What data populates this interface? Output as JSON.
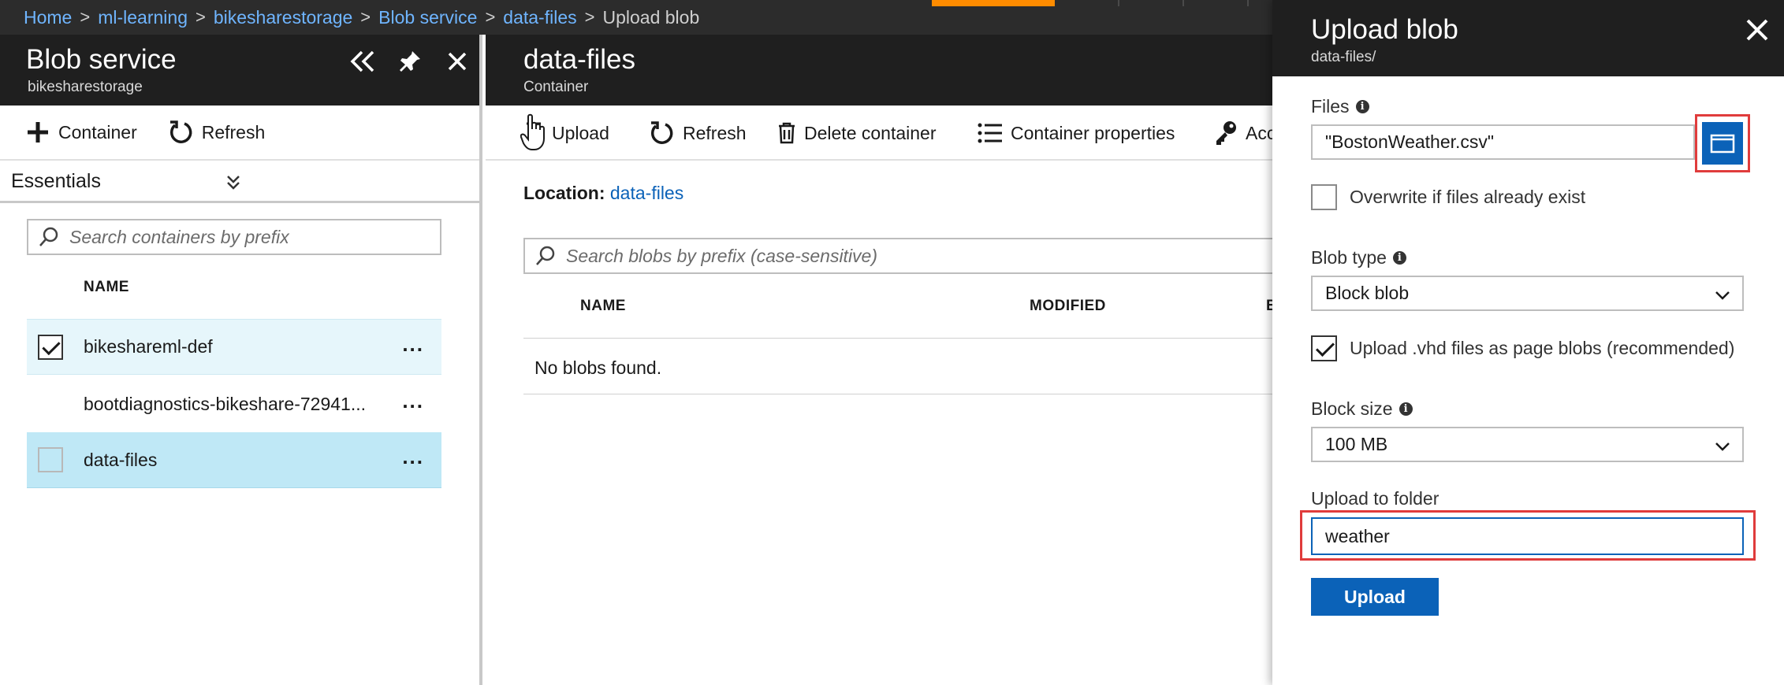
{
  "breadcrumb": {
    "items": [
      {
        "label": "Home"
      },
      {
        "label": "ml-learning"
      },
      {
        "label": "bikesharestorage"
      },
      {
        "label": "Blob service"
      },
      {
        "label": "data-files"
      }
    ],
    "current": "Upload blob",
    "separator": ">"
  },
  "blob_service": {
    "title": "Blob service",
    "subtitle": "bikesharestorage",
    "toolbar": {
      "container_label": "Container",
      "refresh_label": "Refresh"
    },
    "essentials_label": "Essentials",
    "search_placeholder": "Search containers by prefix",
    "column_name": "NAME",
    "containers": [
      {
        "name": "bikeshareml-def",
        "checked": true,
        "more": "..."
      },
      {
        "name": "bootdiagnostics-bikeshare-72941...",
        "checked": false,
        "more": "..."
      },
      {
        "name": "data-files",
        "checked": false,
        "more": "..."
      }
    ]
  },
  "container_blade": {
    "title": "data-files",
    "subtitle": "Container",
    "toolbar": {
      "upload_label": "Upload",
      "refresh_label": "Refresh",
      "delete_label": "Delete container",
      "properties_label": "Container properties",
      "access_label": "Acc"
    },
    "location_label": "Location:",
    "location_value": "data-files",
    "search_placeholder": "Search blobs by prefix (case-sensitive)",
    "columns": [
      "NAME",
      "MODIFIED",
      "B"
    ],
    "empty_message": "No blobs found."
  },
  "upload_blade": {
    "title": "Upload blob",
    "subtitle": "data-files/",
    "files_label": "Files",
    "files_value": "\"BostonWeather.csv\"",
    "overwrite_label": "Overwrite if files already exist",
    "overwrite_checked": false,
    "blob_type_label": "Blob type",
    "blob_type_value": "Block blob",
    "vhd_label": "Upload .vhd files as page blobs (recommended)",
    "vhd_checked": true,
    "block_size_label": "Block size",
    "block_size_value": "100 MB",
    "folder_label": "Upload to folder",
    "folder_value": "weather",
    "upload_button": "Upload"
  },
  "colors": {
    "accent_orange": "#ff8c00",
    "link_blue": "#0b62b8",
    "highlight_red": "#e03c3c",
    "header_dark": "#1f1f1f"
  }
}
